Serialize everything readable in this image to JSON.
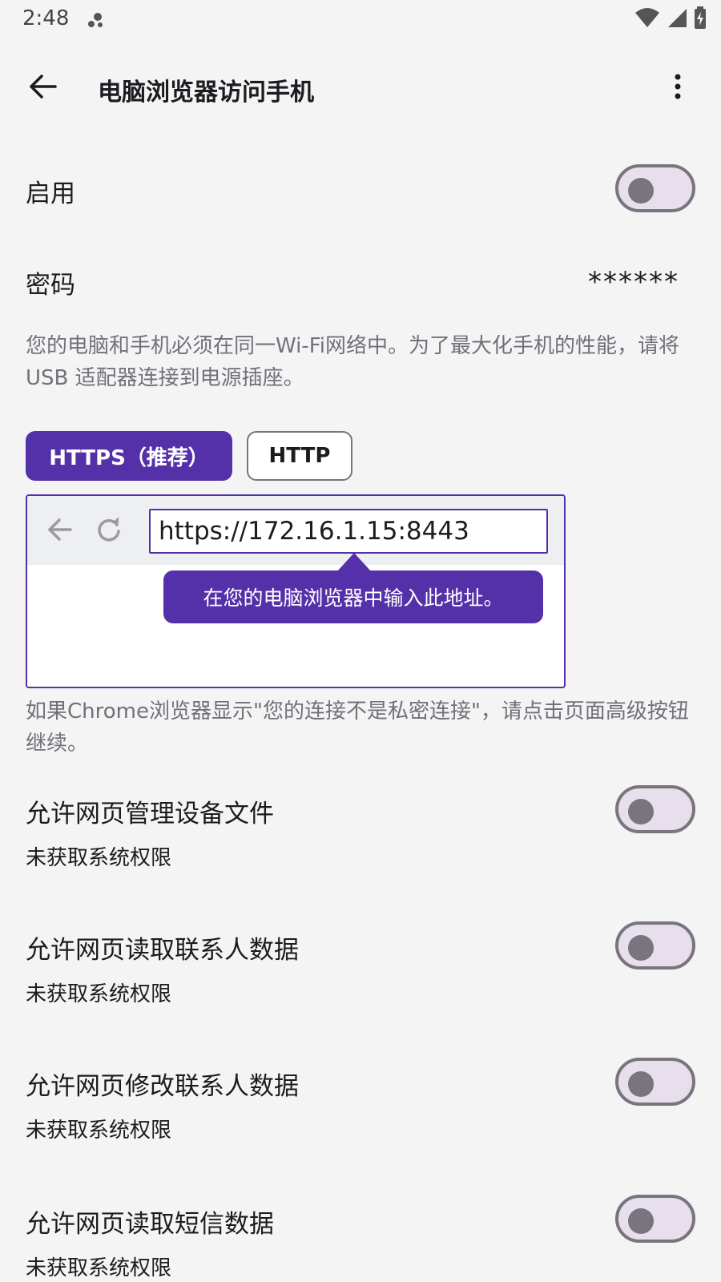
{
  "status_bar": {
    "time": "2:48"
  },
  "app_bar": {
    "title": "电脑浏览器访问手机"
  },
  "settings": {
    "enable_label": "启用",
    "password_label": "密码",
    "password_value": "******",
    "network_note": "您的电脑和手机必须在同一Wi-Fi网络中。为了最大化手机的性能，请将 USB 适配器连接到电源插座。"
  },
  "protocol": {
    "https_label": "HTTPS（推荐）",
    "http_label": "HTTP",
    "selected": "HTTPS（推荐）"
  },
  "browser_demo": {
    "address": "https://172.16.1.15:8443",
    "tooltip": "在您的电脑浏览器中输入此地址。"
  },
  "chrome_note": "如果Chrome浏览器显示\"您的连接不是私密连接\"，请点击页面高级按钮继续。",
  "permissions": [
    {
      "label": "允许网页管理设备文件",
      "status": "未获取系统权限"
    },
    {
      "label": "允许网页读取联系人数据",
      "status": "未获取系统权限"
    },
    {
      "label": "允许网页修改联系人数据",
      "status": "未获取系统权限"
    },
    {
      "label": "允许网页读取短信数据",
      "status": "未获取系统权限"
    }
  ],
  "colors": {
    "accent": "#5431a9",
    "background": "#f4f4f5",
    "secondary_text": "#727078",
    "toggle_track": "#e7e0ec",
    "toggle_outline": "#79747e"
  }
}
